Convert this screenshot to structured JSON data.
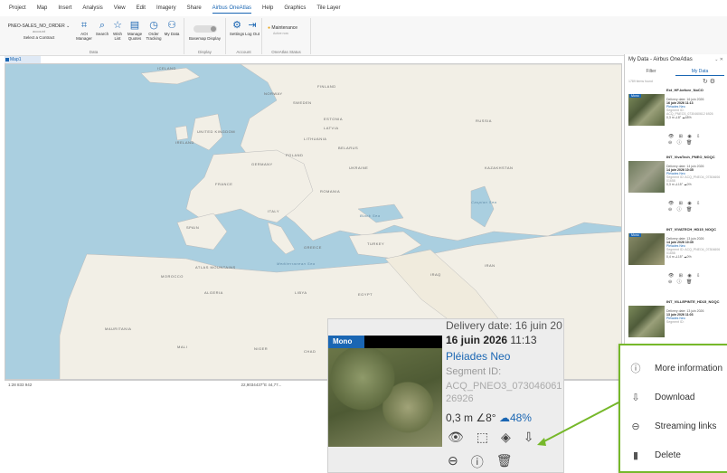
{
  "menubar": {
    "tabs": [
      "Project",
      "Map",
      "Insert",
      "Analysis",
      "View",
      "Edit",
      "Imagery",
      "Share",
      "Airbus OneAtlas",
      "Help",
      "Graphics",
      "Tile Layer"
    ],
    "active_index": 8
  },
  "ribbon": {
    "contract_select": "PNEO-SALES_NO_ORDER",
    "contract_sub": "account",
    "contract_label": "Select a Contract",
    "buttons": [
      "AOI Manager",
      "Search",
      "Wish List",
      "Manage Quotes",
      "Order Tracking",
      "My Data"
    ],
    "data_group": "Data",
    "basemap_label": "Basemap Display",
    "display_group": "Display",
    "settings_label": "Settings",
    "logout_label": "Log Out",
    "account_group": "Account",
    "maintenance": "Maintenance",
    "maintenance_sub": "Active now",
    "status_group": "OneAtlas Status"
  },
  "map": {
    "tab": "Map1",
    "labels": [
      "ICELAND",
      "NORWAY",
      "SWEDEN",
      "FINLAND",
      "RUSSIA",
      "ESTONIA",
      "LATVIA",
      "LITHUANIA",
      "IRELAND",
      "UNITED KINGDOM",
      "POLAND",
      "GERMANY",
      "BELARUS",
      "UKRAINE",
      "FRANCE",
      "ROMANIA",
      "SPAIN",
      "ITALY",
      "TURKEY",
      "GREECE",
      "KAZAKHSTAN",
      "MOROCCO",
      "ALGERIA",
      "LIBYA",
      "EGYPT",
      "SAUDI ARABIA",
      "IRAN",
      "IRAQ",
      "MAURITANIA",
      "MALI",
      "NIGER",
      "CHAD",
      "SUDAN",
      "Mediterranean Sea",
      "Black Sea",
      "Caspian Sea",
      "ATLAS MOUNTAINS"
    ],
    "scale": "1:28 833 942",
    "coords": "22,9034437°E 44,77...",
    "status_right": "Features: 0 |"
  },
  "panel": {
    "title": "My Data - Airbus OneAtlas",
    "tabs": [
      "Filter",
      "My Data"
    ],
    "active_tab": 1,
    "count": "1789 items found",
    "cards": [
      {
        "name": "Ext_HF-before_NoCO",
        "delivery": "Delivery date: 16 juin 2026",
        "date": "16 juin 2026 11:13",
        "sat": "Pléiades Neo",
        "seg": "Segment ID: ACQ_PNEO3_0730460612 6926",
        "stats": "0,3 m ∠8° ☁48%"
      },
      {
        "name": "INT_VivaTech_PNEO_NOQC",
        "delivery": "Delivery date: 14 juin 2026",
        "date": "14 juin 2026 10:35",
        "sat": "Pléiades Neo",
        "seg": "Segment ID: ACQ_PNEO4_07304606 01658",
        "stats": "0,3 m ∠15° ☁0%"
      },
      {
        "name": "INT_VIVATECH_HD15_NOQC",
        "delivery": "Delivery date: 13 juin 2026",
        "date": "14 juin 2026 10:35",
        "sat": "Pléiades Neo",
        "seg": "Segment ID: ACQ_PNEO4_07304606 01658",
        "stats": "0,4 m ∠15° ☁0%"
      },
      {
        "name": "INT_VILLEPINTE_HD15_NOQC",
        "delivery": "Delivery date: 13 juin 2026",
        "date": "13 juin 2026 11:03",
        "sat": "Pléiades Neo",
        "seg": "Segment ID:",
        "stats": ""
      }
    ],
    "badge": "Mono"
  },
  "zoom": {
    "badge": "Mono",
    "delivery": "Delivery date: 16 juin 20",
    "date_bold": "16 juin 2026",
    "time": "11:13",
    "satellite": "Pléiades Neo",
    "seg_label": "Segment ID:",
    "seg_value": "ACQ_PNEO3_07304606126926",
    "gsd": "0,3 m",
    "angle": "∠8°",
    "cloud": "☁48%"
  },
  "menu": {
    "items": [
      "More information",
      "Download",
      "Streaming links",
      "Delete"
    ],
    "icons": [
      "info-icon",
      "download-icon",
      "link-icon",
      "trash-icon"
    ]
  },
  "colors": {
    "accent": "#1a66b3",
    "callout": "#76b82a"
  }
}
